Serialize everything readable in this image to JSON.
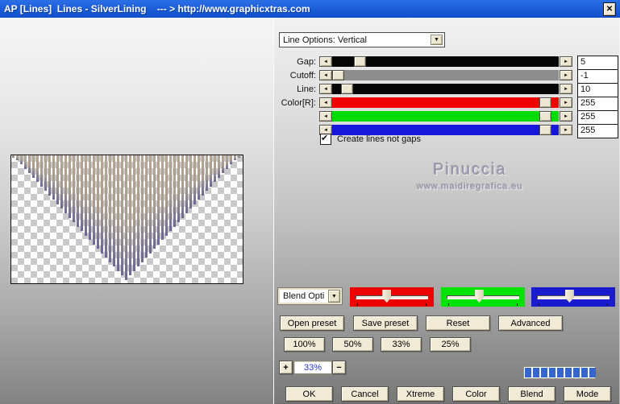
{
  "window": {
    "title": "AP [Lines]  Lines - SilverLining    --- > http://www.graphicxtras.com"
  },
  "glyphs": {
    "close": "✕",
    "dropdown_arrow": "▼",
    "left_arrow": "◄",
    "right_arrow": "►",
    "check": "✔"
  },
  "controls": {
    "line_options_dropdown": "Line Options: Vertical",
    "sliders": [
      {
        "label": "Gap:",
        "value": "5",
        "track": "#060606",
        "thumb": 0.1
      },
      {
        "label": "Cutoff:",
        "value": "-1",
        "track": "#8d8d8d",
        "thumb": 0.0
      },
      {
        "label": "Line:",
        "value": "10",
        "track": "#060606",
        "thumb": 0.04
      },
      {
        "label": "Color[R]:",
        "value": "255",
        "track": "#f20000",
        "thumb": 0.965
      },
      {
        "label": "",
        "value": "255",
        "track": "#00dc00",
        "thumb": 0.965
      },
      {
        "label": "",
        "value": "255",
        "track": "#1717dc",
        "thumb": 0.965
      }
    ],
    "checkbox": {
      "label": "Create lines not gaps",
      "checked": true
    }
  },
  "watermark": {
    "name": "Pinuccia",
    "url": "www.maidiregrafica.eu"
  },
  "blend": {
    "dropdown": "Blend Opti",
    "channels": [
      {
        "name": "red",
        "color": "#ee0000",
        "pos": 0.42
      },
      {
        "name": "green",
        "color": "#00e300",
        "pos": 0.44
      },
      {
        "name": "blue",
        "color": "#1a1ace",
        "pos": 0.44
      }
    ]
  },
  "preset_buttons": [
    "Open preset",
    "Save preset",
    "Reset",
    "Advanced"
  ],
  "zoom_presets": [
    "100%",
    "50%",
    "33%",
    "25%"
  ],
  "zoom_control": {
    "plus": "+",
    "value": "33%",
    "minus": "−"
  },
  "progress": {
    "segments": 9,
    "color": "#3565cf"
  },
  "actions": [
    "OK",
    "Cancel",
    "Xtreme",
    "Color",
    "Blend",
    "Mode"
  ],
  "preview": {
    "line_count": 57,
    "line_width": 3,
    "line_gap": 2,
    "height": 155,
    "gradient_top": "#b5a795",
    "gradient_mid": "#a89c8e",
    "gradient_tip": "#6b6794"
  }
}
